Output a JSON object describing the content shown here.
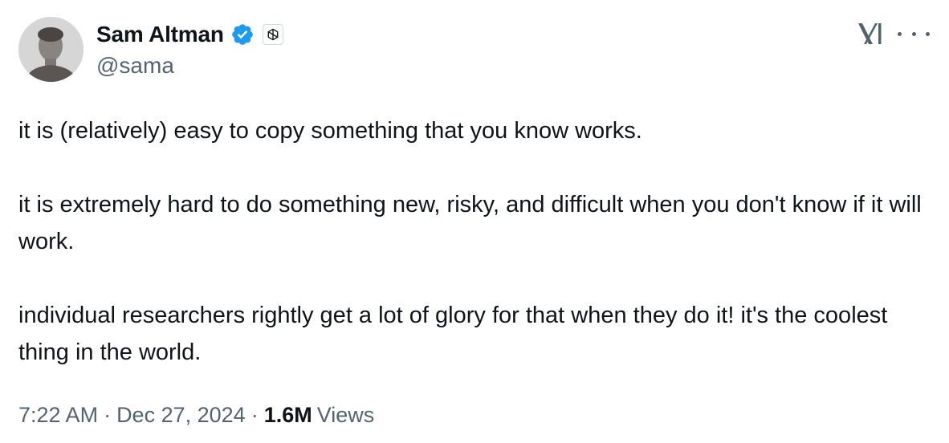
{
  "author": {
    "display_name": "Sam Altman",
    "handle": "@sama",
    "verified": true,
    "verified_color": "#1d9bf0",
    "affiliate_badge": "openai-logo-icon",
    "avatar": "profile-photo"
  },
  "header": {
    "brand_icon": "x-logo-icon",
    "menu_icon": "more-options-icon"
  },
  "tweet": {
    "paragraphs": [
      "it is (relatively) easy to copy something that you know works.",
      "it is extremely hard to do something new, risky, and difficult when you don't know if it will work.",
      "individual researchers rightly get a lot of glory for that when they do it! it's the coolest thing in the world."
    ]
  },
  "meta": {
    "time": "7:22 AM",
    "date": "Dec 27, 2024",
    "separator": "·",
    "views_count": "1.6M",
    "views_label": "Views"
  },
  "colors": {
    "text_primary": "#0f1419",
    "text_secondary": "#536471"
  }
}
